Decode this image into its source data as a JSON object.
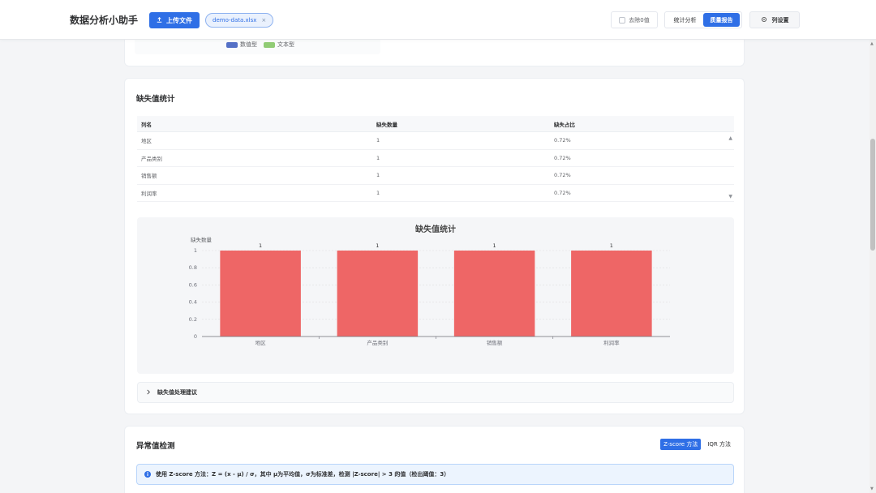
{
  "header": {
    "app_title": "数据分析小助手",
    "upload_label": "上传文件",
    "file_name": "demo-data.xlsx",
    "file_remove": "×",
    "remove_zero_label": "去除0值",
    "tabs": [
      {
        "label": "统计分析",
        "active": false
      },
      {
        "label": "质量报告",
        "active": true
      }
    ],
    "column_settings_label": "列设置"
  },
  "type_legend": {
    "items": [
      {
        "label": "数值型",
        "color": "#5470c6"
      },
      {
        "label": "文本型",
        "color": "#91cc75"
      }
    ]
  },
  "missing": {
    "section_title": "缺失值统计",
    "table": {
      "headers": [
        "列名",
        "缺失数量",
        "缺失占比"
      ],
      "rows": [
        [
          "地区",
          "1",
          "0.72%"
        ],
        [
          "产品类别",
          "1",
          "0.72%"
        ],
        [
          "销售额",
          "1",
          "0.72%"
        ],
        [
          "利润率",
          "1",
          "0.72%"
        ]
      ]
    },
    "suggestion_label": "缺失值处理建议"
  },
  "chart_data": {
    "type": "bar",
    "title": "缺失值统计",
    "ylabel": "缺失数量",
    "xlabel": "",
    "categories": [
      "地区",
      "产品类别",
      "销售额",
      "利润率"
    ],
    "values": [
      1,
      1,
      1,
      1
    ],
    "data_labels": [
      "1",
      "1",
      "1",
      "1"
    ],
    "ylim": [
      0,
      1
    ],
    "yticks": [
      "0",
      "0.2",
      "0.4",
      "0.6",
      "0.8",
      "1"
    ],
    "bar_color": "#ee6666",
    "grid": true
  },
  "outlier": {
    "section_title": "异常值检测",
    "methods": [
      {
        "label": "Z-score 方法",
        "active": true
      },
      {
        "label": "IQR 方法",
        "active": false
      }
    ],
    "info_text": "使用 Z-score 方法：Z = (x - μ) / σ，其中 μ为平均值，σ为标准差，检测 |Z-score| > 3 的值（检出阈值：3）"
  },
  "colors": {
    "primary": "#2f6fe6",
    "bar": "#ee6666"
  }
}
